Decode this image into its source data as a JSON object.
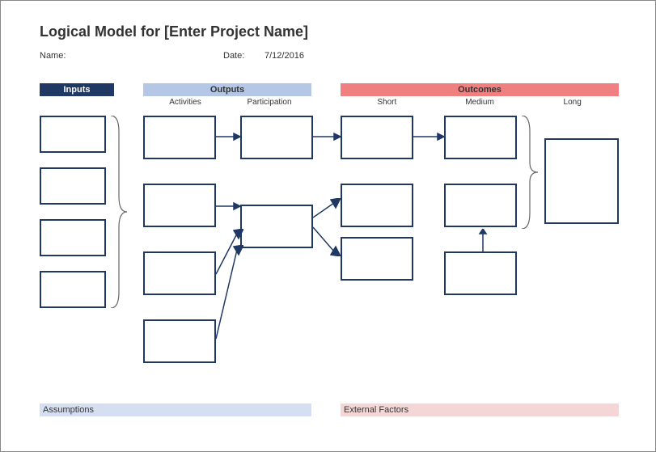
{
  "title": "Logical Model for [Enter Project Name]",
  "meta": {
    "name_label": "Name:",
    "date_label": "Date:",
    "date_value": "7/12/2016"
  },
  "headers": {
    "inputs": "Inputs",
    "outputs": "Outputs",
    "outputs_sub": {
      "activities": "Activities",
      "participation": "Participation"
    },
    "outcomes": "Outcomes",
    "outcomes_sub": {
      "short": "Short",
      "medium": "Medium",
      "long": "Long"
    }
  },
  "footer": {
    "assumptions": "Assumptions",
    "external": "External Factors"
  },
  "colors": {
    "inputs_header": "#1f3864",
    "outputs_header": "#b4c7e7",
    "outcomes_header": "#f08080",
    "box_border": "#1f3864",
    "assumptions_bg": "#d6dff2",
    "external_bg": "#f4d6d6"
  }
}
